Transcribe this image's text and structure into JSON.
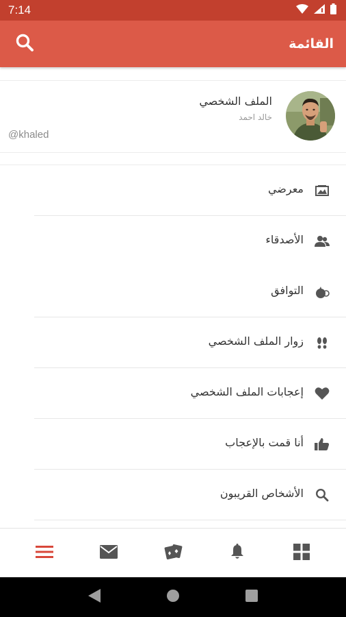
{
  "status_bar": {
    "time": "7:14",
    "icons": [
      "wifi-icon",
      "signal-icon",
      "battery-icon"
    ]
  },
  "app_bar": {
    "title": "القائمة",
    "search_icon": "search-icon"
  },
  "profile": {
    "name": "الملف الشخصي",
    "subtitle": "خالد احمد",
    "handle": "@khaled"
  },
  "menu": {
    "items": [
      {
        "label": "معرضي",
        "icon": "gallery-icon"
      },
      {
        "label": "الأصدقاء",
        "icon": "friends-icon"
      },
      {
        "label": "التوافق",
        "icon": "compatibility-icon"
      },
      {
        "label": "زوار الملف الشخصي",
        "icon": "footprints-icon"
      },
      {
        "label": "إعجابات الملف الشخصي",
        "icon": "heart-icon"
      },
      {
        "label": "أنا قمت بالإعجاب",
        "icon": "thumbs-up-icon"
      },
      {
        "label": "الأشخاص القريبون",
        "icon": "search-icon"
      }
    ]
  },
  "bottom_nav": {
    "items": [
      "menu-icon",
      "mail-icon",
      "cards-icon",
      "bell-icon",
      "grid-icon"
    ],
    "active_index": 0
  },
  "colors": {
    "status_bar": "#c2402e",
    "app_bar": "#dc5a48",
    "accent": "#d8473a",
    "icon_gray": "#555555"
  }
}
